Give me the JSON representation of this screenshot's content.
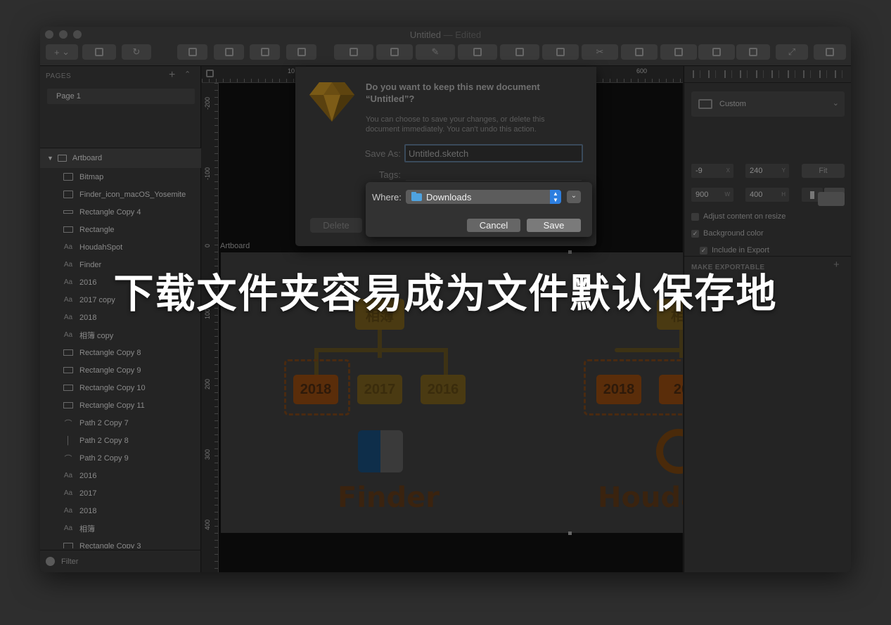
{
  "window": {
    "title": "Untitled",
    "title_suffix": "— Edited"
  },
  "toolbar": {
    "insert_label": "+",
    "buttons": [
      "insert",
      "group",
      "transform",
      "ungroup",
      "forward",
      "backward",
      "edit",
      "mask",
      "scale",
      "union",
      "subtract",
      "intersect",
      "difference",
      "rotate",
      "flatten",
      "mirror",
      "view"
    ]
  },
  "sidebar": {
    "pages_header": "PAGES",
    "add_glyph": "+",
    "collapse_glyph": "⌃",
    "pages": [
      "Page 1"
    ],
    "artboard_name": "Artboard",
    "layers": [
      {
        "icon": "image",
        "name": "Bitmap"
      },
      {
        "icon": "image",
        "name": "Finder_icon_macOS_Yosemite"
      },
      {
        "icon": "thin-rect",
        "name": "Rectangle Copy 4"
      },
      {
        "icon": "rect",
        "name": "Rectangle"
      },
      {
        "icon": "text",
        "name": "HoudahSpot"
      },
      {
        "icon": "text",
        "name": "Finder"
      },
      {
        "icon": "text",
        "name": "2016"
      },
      {
        "icon": "text",
        "name": "2017 copy"
      },
      {
        "icon": "text",
        "name": "2018"
      },
      {
        "icon": "text",
        "name": "相簿 copy"
      },
      {
        "icon": "rect",
        "name": "Rectangle Copy 8"
      },
      {
        "icon": "rect",
        "name": "Rectangle Copy 9"
      },
      {
        "icon": "rect",
        "name": "Rectangle Copy 10"
      },
      {
        "icon": "rect",
        "name": "Rectangle Copy 11"
      },
      {
        "icon": "path",
        "name": "Path 2 Copy 7"
      },
      {
        "icon": "vpath",
        "name": "Path 2 Copy 8"
      },
      {
        "icon": "path",
        "name": "Path 2 Copy 9"
      },
      {
        "icon": "text",
        "name": "2016"
      },
      {
        "icon": "text",
        "name": "2017"
      },
      {
        "icon": "text",
        "name": "2018"
      },
      {
        "icon": "text",
        "name": "相簿"
      },
      {
        "icon": "rect",
        "name": "Rectangle Copy 3"
      }
    ],
    "filter_label": "Filter"
  },
  "canvas": {
    "ruler_top_labels": [
      "10",
      "600"
    ],
    "ruler_left_labels": [
      "-200",
      "-100",
      "0",
      "100",
      "200",
      "300",
      "400"
    ],
    "artboard_label": "Artboard",
    "art": {
      "root_label": "相簿",
      "years": [
        "2018",
        "2017",
        "2016"
      ],
      "brand_left": "Finder",
      "brand_right": "Houda",
      "right_root_label": "相",
      "right_year_1": "2018",
      "right_year_2": "20"
    }
  },
  "inspector": {
    "preset_label": "Custom",
    "x": "-9",
    "x_unit": "X",
    "y": "240",
    "y_unit": "Y",
    "fit_label": "Fit",
    "width": "900",
    "w_unit": "W",
    "height": "400",
    "h_unit": "H",
    "adjust_label": "Adjust content on resize",
    "bg_color_label": "Background color",
    "include_export_label": "Include in Export",
    "make_exportable": "MAKE EXPORTABLE",
    "add_glyph": "+"
  },
  "dialog": {
    "title": "Do you want to keep this new document “Untitled”?",
    "message": "You can choose to save your changes, or delete this document immediately. You can't undo this action.",
    "save_as_label": "Save As:",
    "filename": "Untitled.sketch",
    "tags_label": "Tags:",
    "where_label": "Where:",
    "where_value": "Downloads",
    "delete_label": "Delete",
    "cancel_label": "Cancel",
    "save_label": "Save",
    "updown_glyph": "⌃⌄",
    "expand_glyph": "⌄"
  },
  "caption": "下载文件夹容易成为文件默认保存地",
  "colors": {
    "accent_blue": "#2d7fe0",
    "folder_blue": "#4fa3e0",
    "art_orange": "#c65f10",
    "caption_white": "#ffffff"
  }
}
